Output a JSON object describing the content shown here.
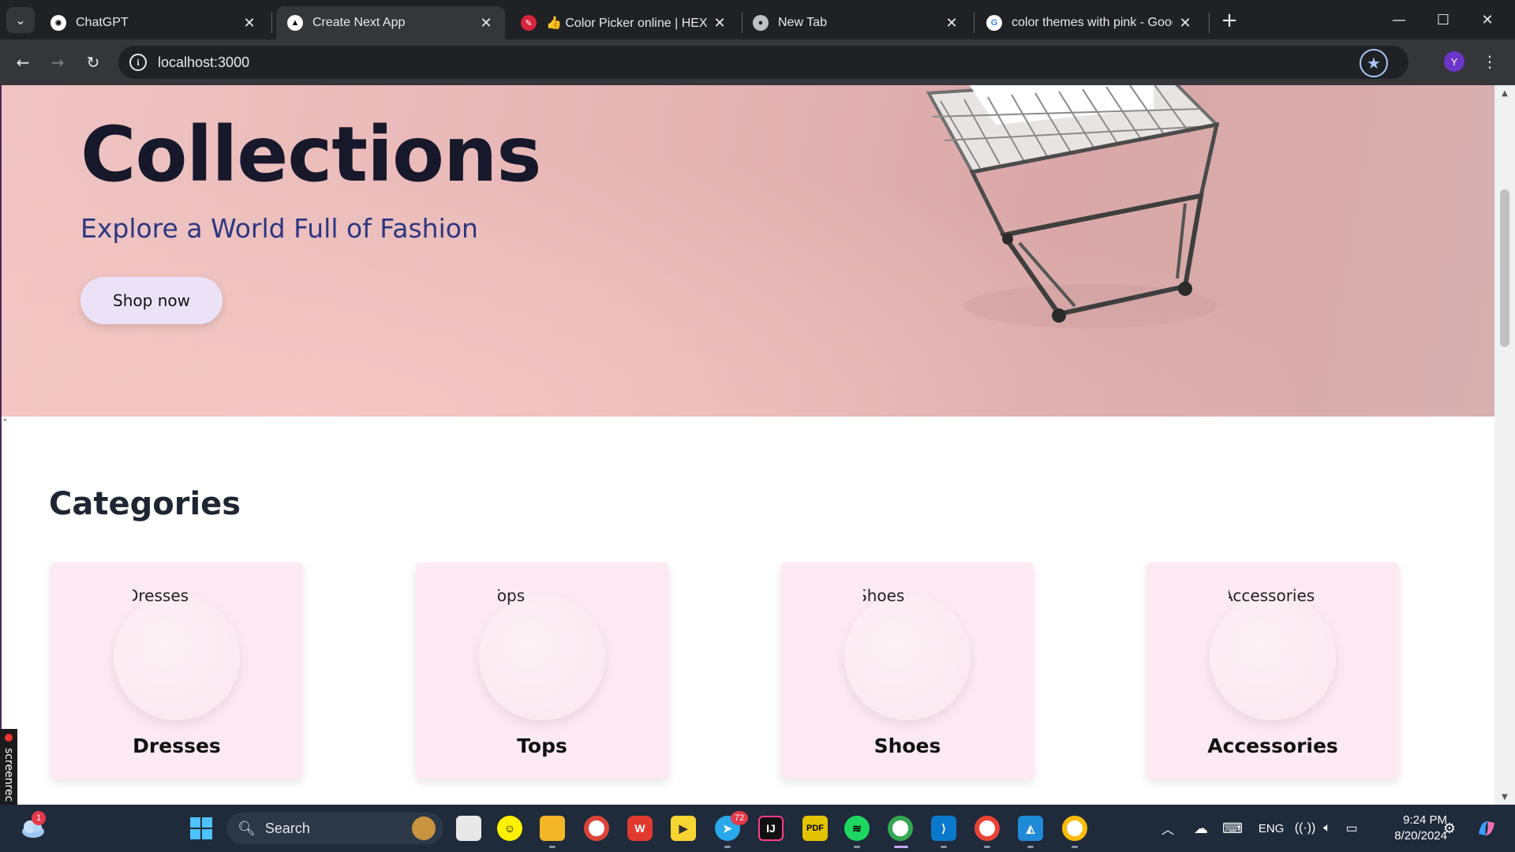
{
  "browser": {
    "tabs": [
      {
        "title": "ChatGPT",
        "icon": "chatgpt-icon"
      },
      {
        "title": "Create Next App",
        "icon": "nextjs-icon",
        "active": true
      },
      {
        "title": "👍 Color Picker online | HEX Co",
        "icon": "color-picker-icon"
      },
      {
        "title": "New Tab",
        "icon": "chrome-icon"
      },
      {
        "title": "color themes with pink - Googl",
        "icon": "google-icon"
      }
    ],
    "address": "localhost:3000",
    "profile_initial": "Y"
  },
  "page": {
    "hero": {
      "title": "Collections",
      "subtitle": "Explore a World Full of Fashion",
      "cta": "Shop now"
    },
    "stray_char": "\"",
    "categories_title": "Categories",
    "categories": [
      {
        "name": "Dresses",
        "alt_visible": "Dresses"
      },
      {
        "name": "Tops",
        "alt_visible": "Tops"
      },
      {
        "name": "Shoes",
        "alt_visible": "Shoes"
      },
      {
        "name": "Accessories",
        "alt_visible": "Accessories"
      }
    ]
  },
  "overlay": {
    "recorder_label": "screenrec"
  },
  "taskbar": {
    "search_label": "Search",
    "weather_badge": "1",
    "telegram_badge": "72",
    "tray": {
      "language": "ENG",
      "time": "9:24 PM",
      "date": "8/20/2024"
    }
  },
  "colors": {
    "hero_title": "#17192b",
    "hero_subtitle": "#2b3782",
    "cta_bg": "#ece2f8",
    "card_bg": "#fde9f2"
  }
}
